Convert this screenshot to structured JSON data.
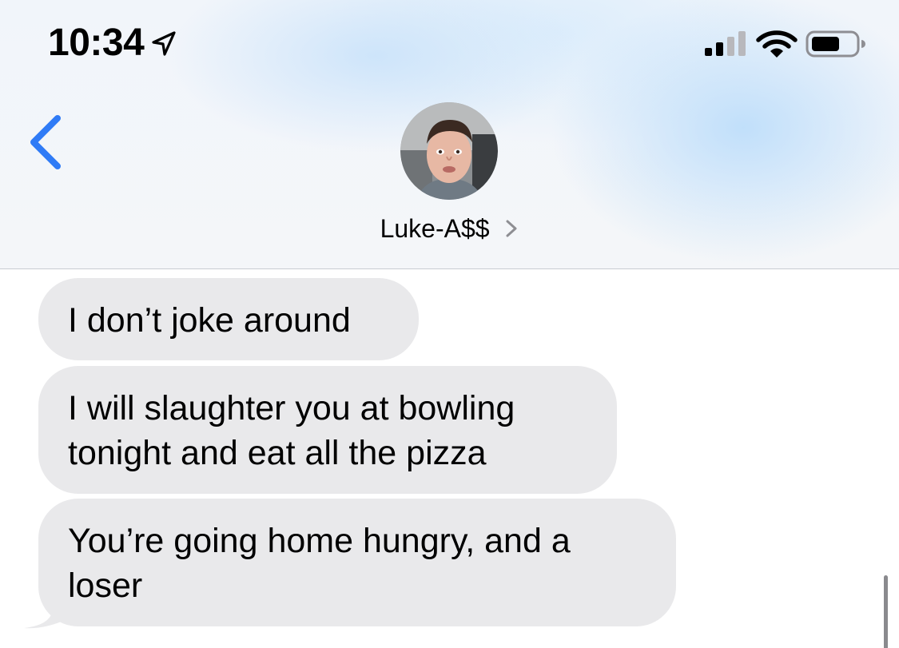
{
  "status_bar": {
    "time": "10:34",
    "icons": [
      "location-arrow-icon",
      "cellular-signal-icon",
      "wifi-icon",
      "battery-icon"
    ]
  },
  "header": {
    "back_icon": "chevron-left-icon",
    "contact_name": "Luke-A$$",
    "contact_chevron_icon": "chevron-right-icon",
    "avatar": "contact-avatar"
  },
  "messages": [
    {
      "direction": "incoming",
      "lines": [
        "I don’t joke around"
      ]
    },
    {
      "direction": "incoming",
      "lines": [
        "I will slaughter you at bowling",
        "tonight and eat all the pizza"
      ]
    },
    {
      "direction": "incoming",
      "lines": [
        "You’re going home hungry, and a",
        "loser"
      ]
    }
  ],
  "colors": {
    "accent": "#2f7bf6",
    "incoming_bubble": "#e9e9eb",
    "text": "#000000",
    "divider": "#c9ccd2"
  }
}
